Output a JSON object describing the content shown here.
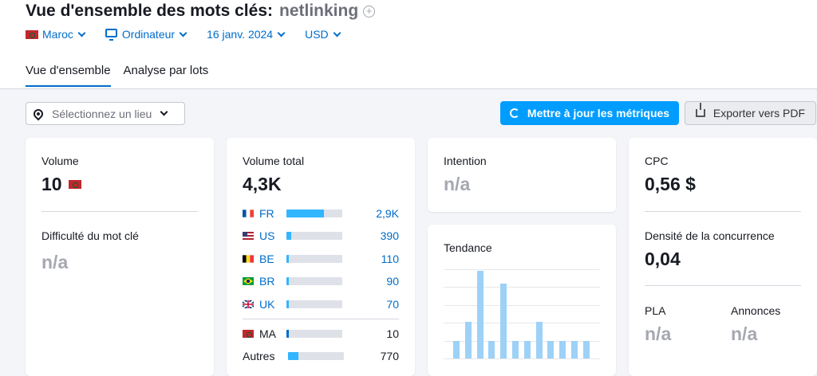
{
  "header": {
    "title": "Vue d'ensemble des mots clés:",
    "keyword": "netlinking",
    "add_symbol": "+"
  },
  "filters": {
    "country": "Maroc",
    "device": "Ordinateur",
    "date": "16 janv. 2024",
    "currency": "USD"
  },
  "tabs": [
    {
      "label": "Vue d'ensemble",
      "active": true
    },
    {
      "label": "Analyse par lots",
      "active": false
    }
  ],
  "location": {
    "placeholder": "Sélectionnez un lieu"
  },
  "actions": {
    "update_label": "Mettre à jour les métriques",
    "export_label": "Exporter vers PDF"
  },
  "volume_card": {
    "label": "Volume",
    "value": "10",
    "difficulty_label": "Difficulté du mot clé",
    "difficulty_value": "n/a"
  },
  "total_card": {
    "label": "Volume total",
    "value": "4,3K",
    "countries": [
      {
        "code": "FR",
        "value": "2,9K",
        "share": 0.67,
        "flag": "fr"
      },
      {
        "code": "US",
        "value": "390",
        "share": 0.09,
        "flag": "us"
      },
      {
        "code": "BE",
        "value": "110",
        "share": 0.03,
        "flag": "be"
      },
      {
        "code": "BR",
        "value": "90",
        "share": 0.02,
        "flag": "br"
      },
      {
        "code": "UK",
        "value": "70",
        "share": 0.02,
        "flag": "uk"
      }
    ],
    "local": {
      "code": "MA",
      "value": "10",
      "share": 0.02,
      "flag": "ma"
    },
    "others": {
      "code": "Autres",
      "value": "770",
      "share": 0.18
    }
  },
  "intent_card": {
    "label": "Intention",
    "value": "n/a"
  },
  "trend_card": {
    "label": "Tendance",
    "values": [
      20,
      42,
      100,
      20,
      85,
      20,
      20,
      42,
      20,
      20,
      20,
      20
    ]
  },
  "cpc_card": {
    "label": "CPC",
    "value": "0,56 $",
    "competition_label": "Densité de la concurrence",
    "competition_value": "0,04",
    "pla_label": "PLA",
    "pla_value": "n/a",
    "ads_label": "Annonces",
    "ads_value": "n/a"
  },
  "colors": {
    "accent": "#006dca",
    "button": "#009dff",
    "bar": "#32b6ff",
    "trend": "#9dd1f7"
  }
}
